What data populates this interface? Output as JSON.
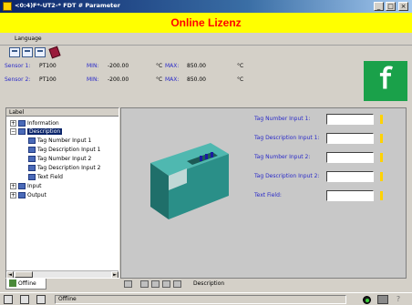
{
  "window": {
    "title": "<0:4)F*-UT2-* FDT # Parameter",
    "min_glyph": "_",
    "max_glyph": "□",
    "close_glyph": "×"
  },
  "banner": {
    "text": "Online Lizenz"
  },
  "menu": {
    "language": "Language"
  },
  "sensors": [
    {
      "label": "Sensor 1:",
      "type": "PT100",
      "min_label": "MIN:",
      "min_value": "-200.00",
      "min_unit": "°C",
      "max_label": "MAX:",
      "max_value": "850.00",
      "max_unit": "°C"
    },
    {
      "label": "Sensor 2:",
      "type": "PT100",
      "min_label": "MIN:",
      "min_value": "-200.00",
      "min_unit": "°C",
      "max_label": "MAX:",
      "max_value": "850.00",
      "max_unit": "°C"
    }
  ],
  "logo": {
    "glyph": "ꬵ",
    "brand_color": "#1aa14a"
  },
  "tree": {
    "header": "Label",
    "items": [
      {
        "label": "Information",
        "expander": "+"
      },
      {
        "label": "Description",
        "expander": "−"
      },
      {
        "label": "Tag Number Input 1"
      },
      {
        "label": "Tag Description Input 1"
      },
      {
        "label": "Tag Number Input 2"
      },
      {
        "label": "Tag Description Input 2"
      },
      {
        "label": "Text Field"
      },
      {
        "label": "Input",
        "expander": "+"
      },
      {
        "label": "Output",
        "expander": "+"
      }
    ],
    "scroll_left": "◄",
    "scroll_right": "►"
  },
  "tabs": {
    "offline": "Offline"
  },
  "form": {
    "fields": [
      {
        "label": "Tag Number Input 1:",
        "value": ""
      },
      {
        "label": "Tag Description Input 1:",
        "value": ""
      },
      {
        "label": "Tag Number Input 2:",
        "value": ""
      },
      {
        "label": "Tag Description Input 2:",
        "value": ""
      },
      {
        "label": "Text Field:",
        "value": ""
      }
    ]
  },
  "nav": {
    "label": "Description"
  },
  "status": {
    "text": "Offline",
    "help_glyph": "?"
  }
}
